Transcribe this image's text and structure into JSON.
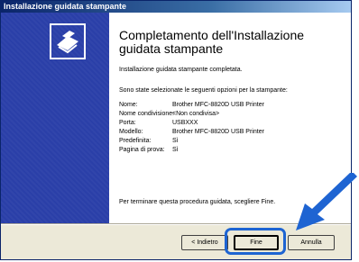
{
  "window": {
    "title": "Installazione guidata stampante"
  },
  "icons": {
    "logo": "printer-setup-icon",
    "pointer": "blue-arrow-icon"
  },
  "main": {
    "heading": "Completamento dell'Installazione guidata stampante",
    "completed": "Installazione guidata stampante completata.",
    "selected_intro": "Sono state selezionate le seguenti opzioni per la stampante:",
    "options": [
      {
        "label": "Nome:",
        "value": "Brother MFC-8820D USB Printer"
      },
      {
        "label": "Nome condivisione:",
        "value": "<Non condivisa>"
      },
      {
        "label": "Porta:",
        "value": "USBXXX"
      },
      {
        "label": "Modello:",
        "value": "Brother MFC-8820D USB Printer"
      },
      {
        "label": "Predefinita:",
        "value": "Sì"
      },
      {
        "label": "Pagina di prova:",
        "value": "Sì"
      }
    ],
    "finish_hint": "Per terminare questa procedura guidata, scegliere Fine."
  },
  "buttons": {
    "back": "< Indietro",
    "finish": "Fine",
    "cancel": "Annulla"
  },
  "colors": {
    "left_panel": "#2a3fa8",
    "highlight": "#1e64d2"
  }
}
